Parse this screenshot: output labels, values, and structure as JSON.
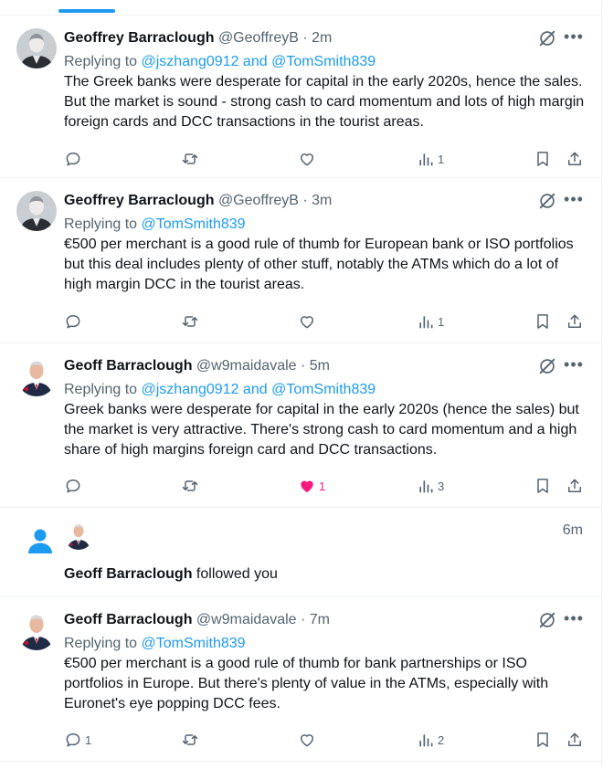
{
  "notifications": [
    {
      "type": "reply",
      "author": "Geoffrey Barraclough",
      "handle": "@GeoffreyB",
      "time": "2m",
      "replying_prefix": "Replying to ",
      "replying_to": "@jszhang0912 and @TomSmith839",
      "text": "The Greek banks were desperate for capital in the early 2020s, hence the sales. But the market is sound - strong cash to card momentum and lots of high margin foreign cards and DCC transactions in the tourist areas.",
      "reply_count": "",
      "like_count": "",
      "views": "1"
    },
    {
      "type": "reply",
      "author": "Geoffrey Barraclough",
      "handle": "@GeoffreyB",
      "time": "3m",
      "replying_prefix": "Replying to ",
      "replying_to": "@TomSmith839",
      "text": "€500 per merchant is a good rule of thumb for European bank or ISO portfolios but this deal includes plenty of other stuff, notably the ATMs which do a lot of high margin DCC in the tourist areas.",
      "reply_count": "",
      "like_count": "",
      "views": "1"
    },
    {
      "type": "reply",
      "author": "Geoff Barraclough",
      "handle": "@w9maidavale",
      "time": "5m",
      "replying_prefix": "Replying to ",
      "replying_to": "@jszhang0912 and @TomSmith839",
      "text": "Greek banks were desperate for capital in the early 2020s (hence the sales) but the market is very attractive. There's strong cash to card momentum and a high share of high margins foreign card and DCC transactions.",
      "reply_count": "",
      "like_count": "1",
      "views": "3"
    },
    {
      "type": "follow",
      "author": "Geoff Barraclough",
      "action": " followed you",
      "time": "6m"
    },
    {
      "type": "reply",
      "author": "Geoff Barraclough",
      "handle": "@w9maidavale",
      "time": "7m",
      "replying_prefix": "Replying to ",
      "replying_to": "@TomSmith839",
      "text": "€500 per merchant is a good rule of thumb for bank partnerships or ISO portfolios in Europe. But there's plenty of value in the ATMs, especially with Euronet's eye popping DCC fees.",
      "reply_count": "1",
      "like_count": "",
      "views": "2"
    }
  ],
  "separator": " · ",
  "more_label": "•••",
  "icons": [
    "reply-icon",
    "retweet-icon",
    "like-icon",
    "views-icon",
    "bookmark-icon",
    "share-icon",
    "grok-icon",
    "more-icon",
    "person-icon"
  ],
  "colors": {
    "accent": "#1d9bf0",
    "like": "#f91880",
    "muted": "#536471",
    "text": "#0f1419"
  }
}
